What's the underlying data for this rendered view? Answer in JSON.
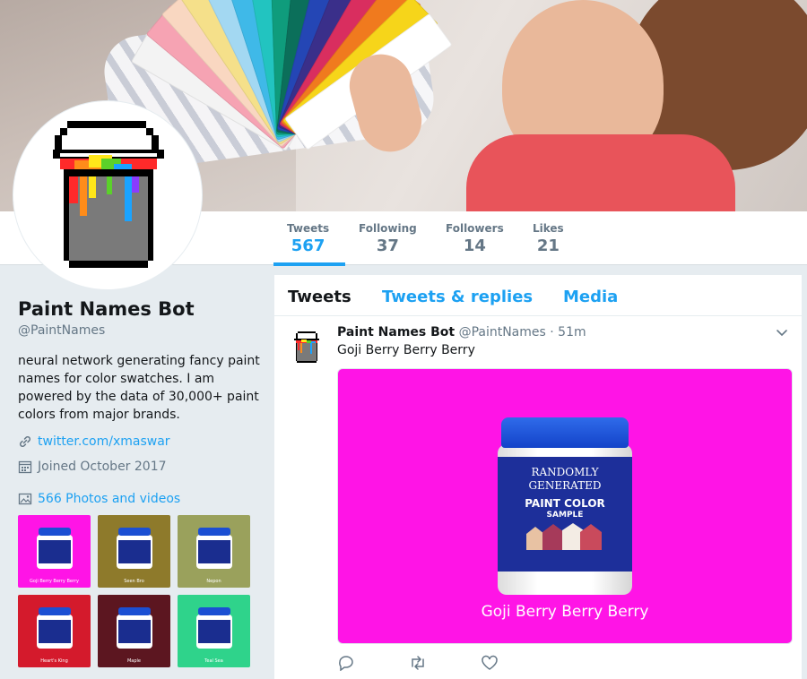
{
  "profile": {
    "name": "Paint Names Bot",
    "handle": "@PaintNames",
    "bio": "neural network generating fancy paint names for color swatches. I am powered by the data of 30,000+ paint colors from major brands.",
    "website": "twitter.com/xmaswar",
    "joined": "Joined October 2017",
    "media_count_label": "566 Photos and videos"
  },
  "stats": [
    {
      "label": "Tweets",
      "value": "567"
    },
    {
      "label": "Following",
      "value": "37"
    },
    {
      "label": "Followers",
      "value": "14"
    },
    {
      "label": "Likes",
      "value": "21"
    }
  ],
  "tabs": [
    "Tweets",
    "Tweets & replies",
    "Media"
  ],
  "thumbnails": [
    {
      "caption": "Goji Berry Berry Berry",
      "color": "#ff14e6"
    },
    {
      "caption": "Seen Bro",
      "color": "#8e7a2b"
    },
    {
      "caption": "Nepon",
      "color": "#9aa15c"
    },
    {
      "caption": "Heart's King",
      "color": "#d41a2c"
    },
    {
      "caption": "Maple",
      "color": "#5c1620"
    },
    {
      "caption": "Teal Sea",
      "color": "#2fd38b"
    }
  ],
  "tweet": {
    "name": "Paint Names Bot",
    "handle": "@PaintNames",
    "time": "· 51m",
    "text": "Goji Berry Berry Berry",
    "media": {
      "bg_color": "#ff14e6",
      "label_line1": "RANDOMLY",
      "label_line2": "GENERATED",
      "label_product": "PAINT COLOR",
      "label_sample": "SAMPLE",
      "caption": "Goji Berry Berry Berry"
    }
  },
  "icons": {
    "link": "link-icon",
    "calendar": "calendar-icon",
    "photo": "photo-icon",
    "reply": "reply-icon",
    "retweet": "retweet-icon",
    "like": "like-icon",
    "caret": "chevron-down-icon"
  },
  "colors": {
    "accent": "#1da1f2",
    "text": "#14171a",
    "muted": "#657786",
    "background": "#e6ecf0"
  }
}
